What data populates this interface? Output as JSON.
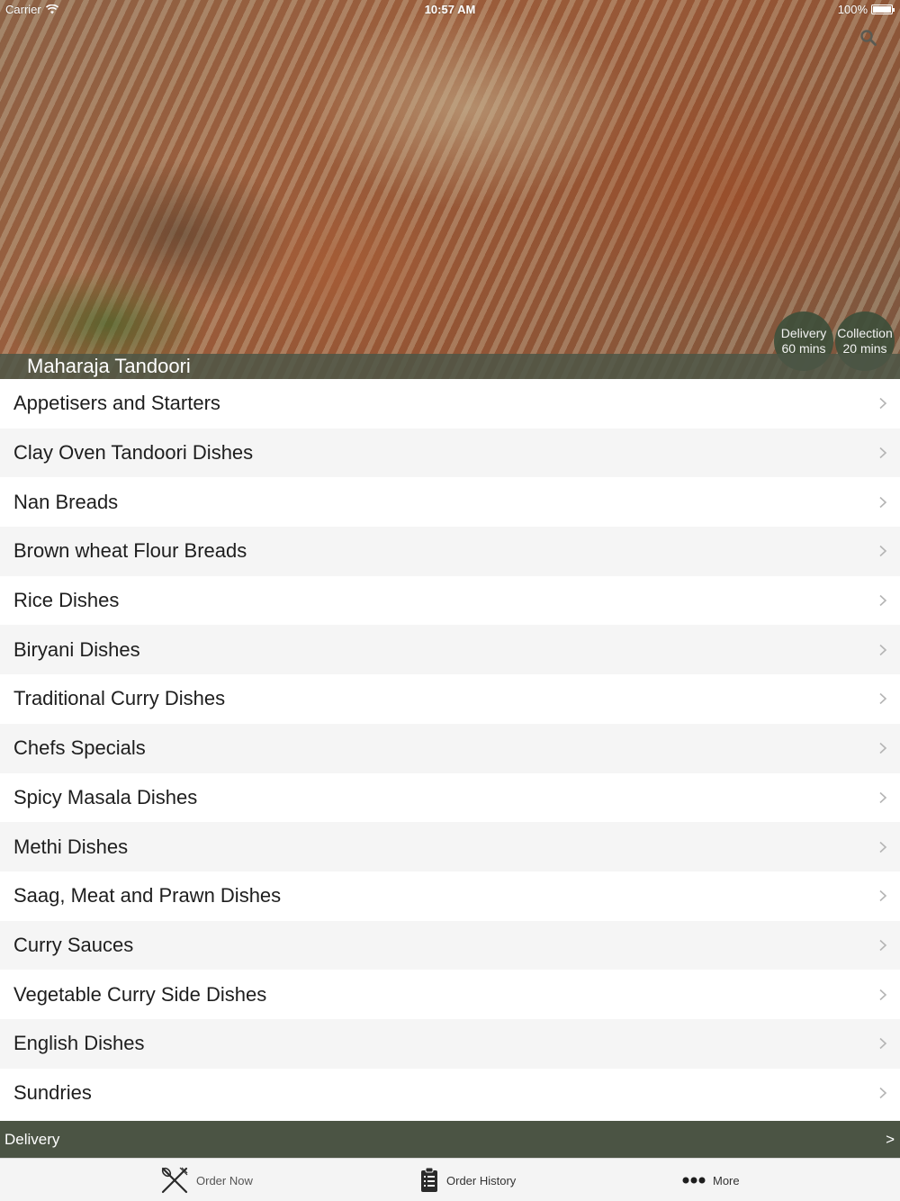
{
  "status_bar": {
    "carrier": "Carrier",
    "time": "10:57 AM",
    "battery": "100%"
  },
  "restaurant": {
    "name": "Maharaja Tandoori",
    "delivery": {
      "label": "Delivery",
      "time": "60 mins"
    },
    "collection": {
      "label": "Collection",
      "time": "20 mins"
    }
  },
  "categories": [
    "Appetisers and Starters",
    "Clay Oven Tandoori Dishes",
    "Nan Breads",
    "Brown wheat Flour Breads",
    "Rice Dishes",
    "Biryani Dishes",
    "Traditional Curry Dishes",
    "Chefs Specials",
    "Spicy Masala Dishes",
    "Methi Dishes",
    "Saag, Meat and Prawn Dishes",
    "Curry Sauces",
    "Vegetable Curry Side Dishes",
    "English Dishes",
    "Sundries"
  ],
  "delivery_bar": {
    "label": "Delivery",
    "arrow": ">"
  },
  "tab_bar": {
    "order_now": "Order Now",
    "order_history": "Order History",
    "more": "More"
  },
  "colors": {
    "accent": "#4b5444",
    "badge": "#3e4e3a",
    "row_alt": "#f5f5f5"
  },
  "icons": {
    "search": "search-icon",
    "chevron": "chevron-right-icon",
    "order_now": "fork-knife-icon",
    "order_history": "clipboard-icon",
    "more": "ellipsis-icon"
  }
}
